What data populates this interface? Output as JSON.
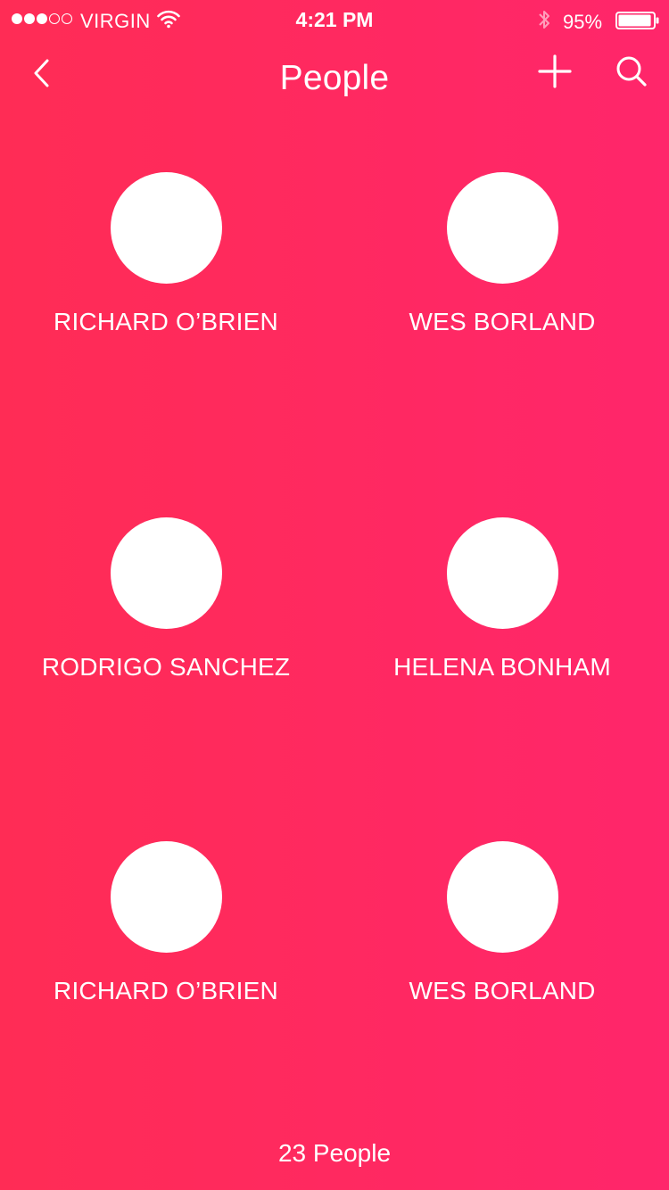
{
  "status_bar": {
    "carrier": "VIRGIN",
    "time": "4:21 PM",
    "battery_percent": "95%",
    "signal_strength": 3,
    "signal_max": 5,
    "battery_level": 0.95
  },
  "nav": {
    "title": "People",
    "back_icon": "chevron-left-icon",
    "add_icon": "plus-icon",
    "search_icon": "search-icon"
  },
  "people": [
    {
      "name": "RICHARD O’BRIEN"
    },
    {
      "name": "WES BORLAND"
    },
    {
      "name": "RODRIGO SANCHEZ"
    },
    {
      "name": "HELENA BONHAM"
    },
    {
      "name": "RICHARD O’BRIEN"
    },
    {
      "name": "WES BORLAND"
    }
  ],
  "footer": {
    "count_label": "23 People"
  },
  "colors": {
    "gradient_start": "#ff2c55",
    "gradient_end": "#ff266b",
    "foreground": "#ffffff"
  }
}
